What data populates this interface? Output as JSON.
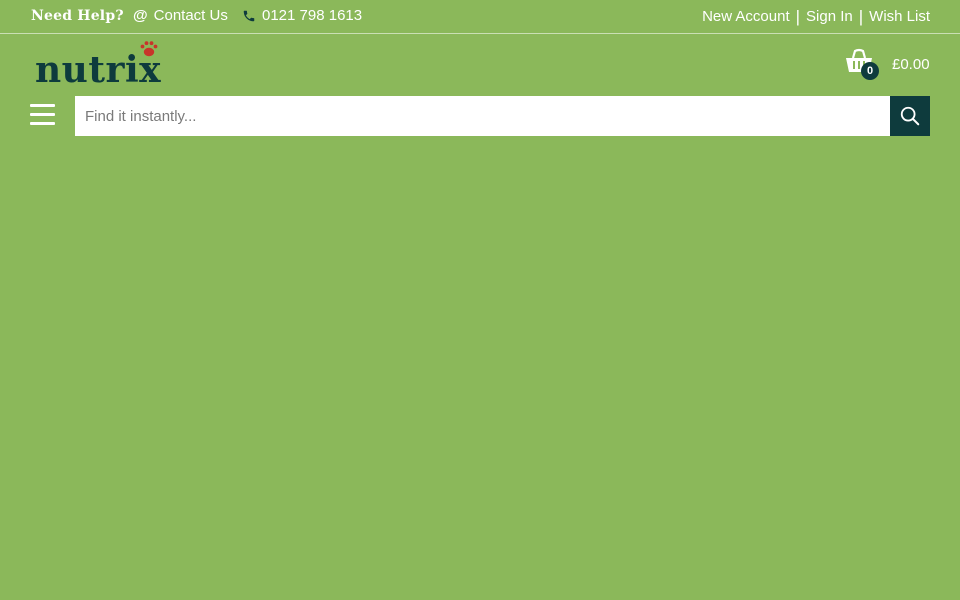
{
  "topbar": {
    "help_label": "Need Help?",
    "contact_label": "Contact Us",
    "phone_number": "0121 798 1613",
    "account_links": [
      {
        "label": "New Account"
      },
      {
        "label": "Sign In"
      },
      {
        "label": "Wish List"
      }
    ],
    "separator": "|"
  },
  "brand": {
    "name": "nutrix",
    "logo_color": "#0e3b3d",
    "paw_color": "#c8352a"
  },
  "cart": {
    "count": "0",
    "total": "£0.00"
  },
  "search": {
    "placeholder": "Find it instantly..."
  },
  "colors": {
    "background": "#8bb85a",
    "accent_dark": "#0e3b3d",
    "text_light": "#ffffff"
  },
  "icons": {
    "contact": "at-icon",
    "phone": "phone-icon",
    "cart": "basket-icon",
    "menu": "hamburger-icon",
    "search": "search-icon"
  }
}
